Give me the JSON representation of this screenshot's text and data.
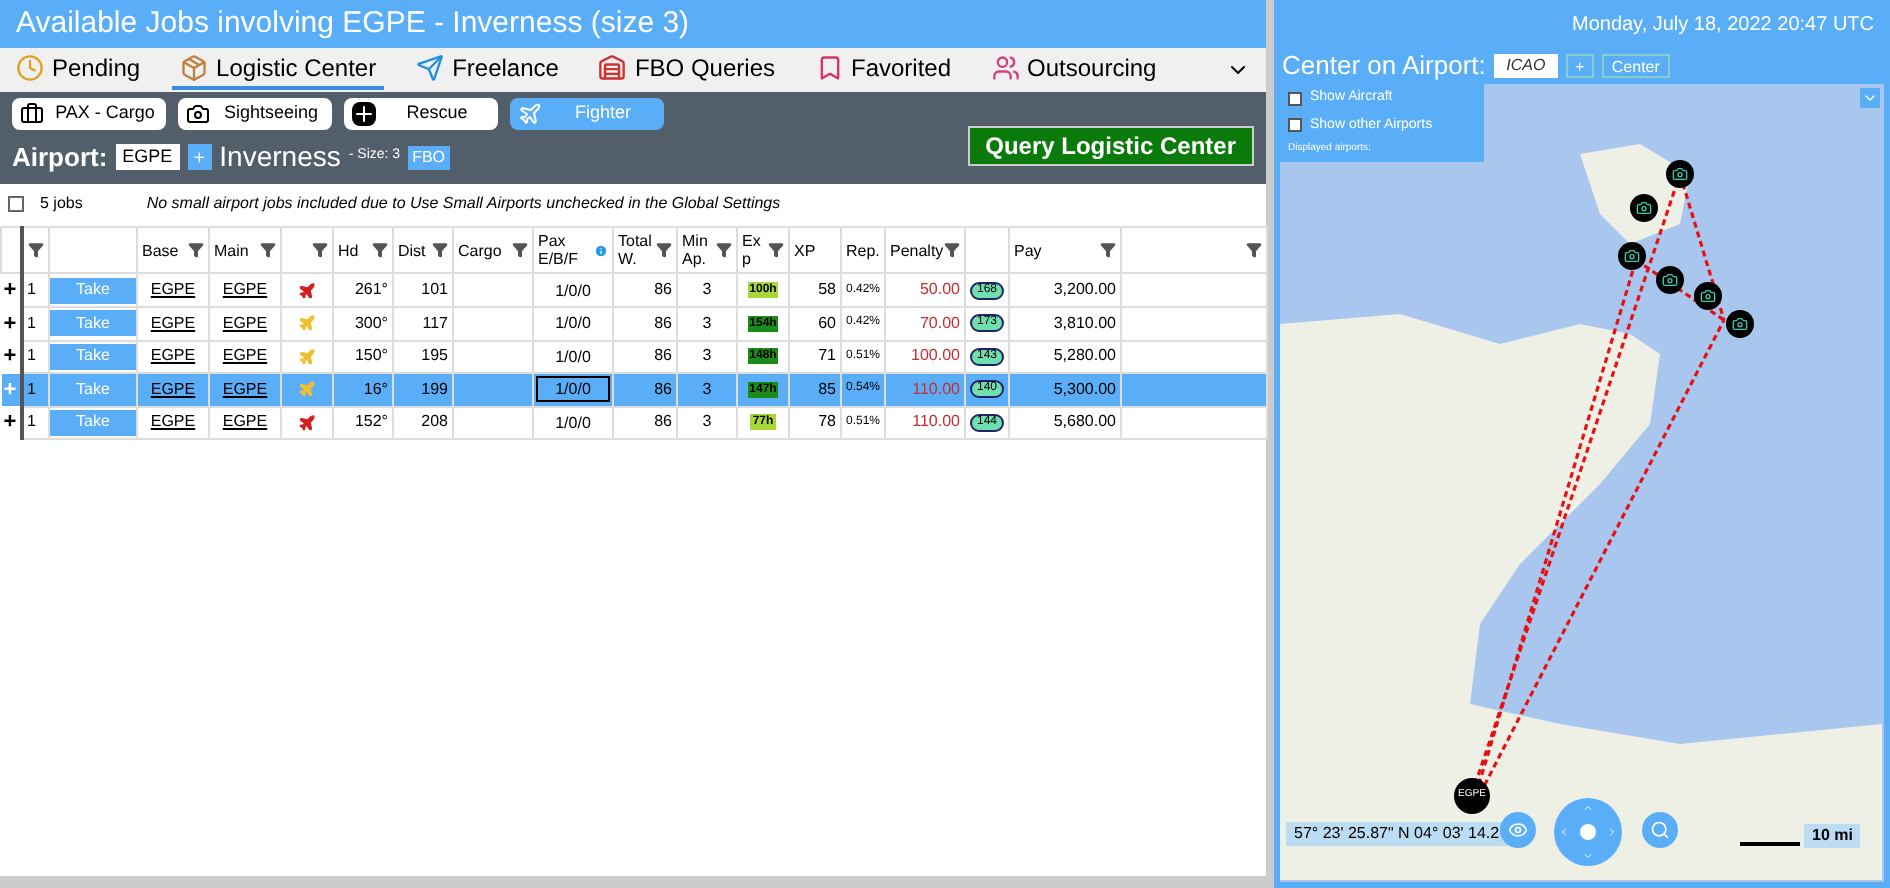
{
  "title": "Available Jobs involving EGPE - Inverness (size 3)",
  "datetime": "Monday, July 18, 2022 20:47 UTC",
  "tabs": [
    {
      "label": "Pending",
      "selected": false
    },
    {
      "label": "Logistic Center",
      "selected": true
    },
    {
      "label": "Freelance",
      "selected": false
    },
    {
      "label": "FBO Queries",
      "selected": false
    },
    {
      "label": "Favorited",
      "selected": false
    },
    {
      "label": "Outsourcing",
      "selected": false
    }
  ],
  "categories": [
    {
      "label": "PAX - Cargo",
      "selected": false
    },
    {
      "label": "Sightseeing",
      "selected": false
    },
    {
      "label": "Rescue",
      "selected": false
    },
    {
      "label": "Fighter",
      "selected": true
    }
  ],
  "airport": {
    "label": "Airport:",
    "value": "EGPE",
    "add": "+",
    "name": "Inverness",
    "size": "- Size: 3",
    "fbo": "FBO"
  },
  "query_button": "Query Logistic Center",
  "summary": {
    "checked": false,
    "count": "5 jobs",
    "note": "No small airport jobs included due to Use Small Airports unchecked in the Global Settings"
  },
  "columns": [
    "Base",
    "Main",
    "Hd",
    "Dist",
    "Cargo",
    "Pax E/B/F",
    "Total W.",
    "Min Ap.",
    "Ex p",
    "XP",
    "Rep.",
    "Penalty",
    "Pay"
  ],
  "rows": [
    {
      "expand": "+",
      "qty": "1",
      "action": "Take",
      "base": "EGPE",
      "main": "EGPE",
      "plane": {
        "color": "#d42020"
      },
      "hd": "261°",
      "dist": "101",
      "pax": "1/0/0",
      "total": "86",
      "min": "3",
      "exp": {
        "label": "100h",
        "color": "#a6d83a"
      },
      "xp": "58",
      "rep": "0.42%",
      "penalty": "50.00",
      "badge": "168",
      "pay": "3,200.00",
      "selected": false
    },
    {
      "expand": "+",
      "qty": "1",
      "action": "Take",
      "base": "EGPE",
      "main": "EGPE",
      "plane": {
        "color": "#f0c030"
      },
      "hd": "300°",
      "dist": "117",
      "pax": "1/0/0",
      "total": "86",
      "min": "3",
      "exp": {
        "label": "154h",
        "color": "#1a8a1a"
      },
      "xp": "60",
      "rep": "0.42%",
      "penalty": "70.00",
      "badge": "173",
      "pay": "3,810.00",
      "selected": false
    },
    {
      "expand": "+",
      "qty": "1",
      "action": "Take",
      "base": "EGPE",
      "main": "EGPE",
      "plane": {
        "color": "#f0c030"
      },
      "hd": "150°",
      "dist": "195",
      "pax": "1/0/0",
      "total": "86",
      "min": "3",
      "exp": {
        "label": "148h",
        "color": "#1a8a1a"
      },
      "xp": "71",
      "rep": "0.51%",
      "penalty": "100.00",
      "badge": "143",
      "pay": "5,280.00",
      "selected": false
    },
    {
      "expand": "+",
      "qty": "1",
      "action": "Take",
      "base": "EGPE",
      "main": "EGPE",
      "plane": {
        "color": "#f0c030"
      },
      "hd": "16°",
      "dist": "199",
      "pax": "1/0/0",
      "total": "86",
      "min": "3",
      "exp": {
        "label": "147h",
        "color": "#1a8a1a"
      },
      "xp": "85",
      "rep": "0.54%",
      "penalty": "110.00",
      "badge": "140",
      "pay": "5,300.00",
      "selected": true
    },
    {
      "expand": "+",
      "qty": "1",
      "action": "Take",
      "base": "EGPE",
      "main": "EGPE",
      "plane": {
        "color": "#d42020"
      },
      "hd": "152°",
      "dist": "208",
      "pax": "1/0/0",
      "total": "86",
      "min": "3",
      "exp": {
        "label": "77h",
        "color": "#a6d83a"
      },
      "xp": "78",
      "rep": "0.51%",
      "penalty": "110.00",
      "badge": "144",
      "pay": "5,680.00",
      "selected": false
    }
  ],
  "map": {
    "center_label": "Center on Airport:",
    "icao_placeholder": "ICAO",
    "add": "+",
    "center_button": "Center",
    "options": [
      {
        "label": "Show Aircraft",
        "checked": false
      },
      {
        "label": "Show other Airports",
        "checked": false
      }
    ],
    "displayed": "Displayed airports:",
    "marker": "EGPE",
    "coords": "57° 23' 25.87\" N 04° 03' 14.2",
    "scale": "10 mi"
  }
}
